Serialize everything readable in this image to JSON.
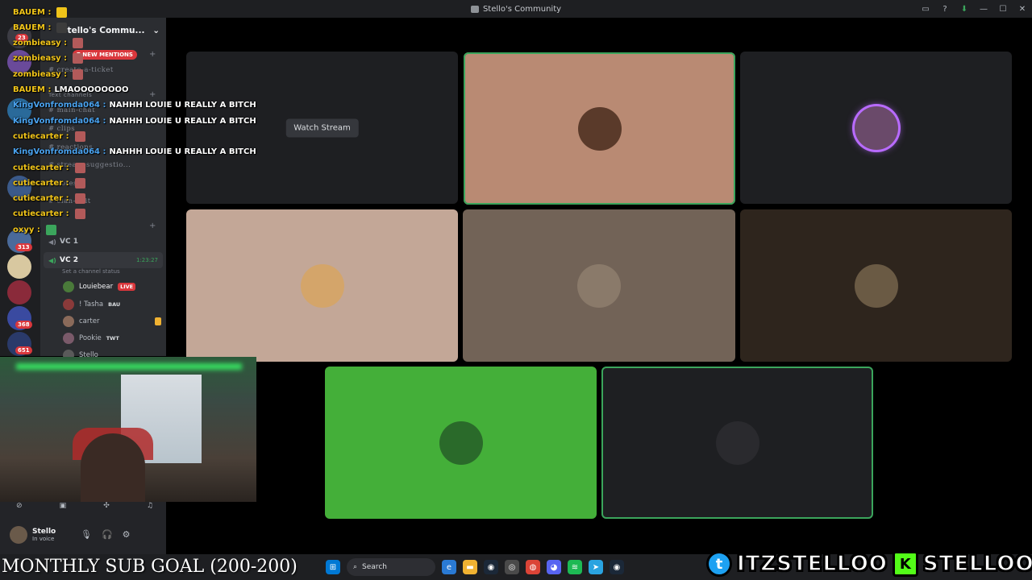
{
  "window": {
    "title": "Stello's Community"
  },
  "server": {
    "name": "Stello's Commu...",
    "new_mentions": "7 NEW MENTIONS",
    "badges": [
      "23",
      "313",
      "368",
      "651"
    ]
  },
  "channels": {
    "text_category": "Text channels",
    "items": [
      "create-a-ticket",
      "main-chat",
      "clips",
      "reactions",
      "stream-suggestio...",
      "votes",
      "clan-bait"
    ]
  },
  "voice": {
    "vc1": "VC 1",
    "vc2": "VC 2",
    "vc2_timer": "1:23:27",
    "vc2_status": "Set a channel status",
    "members": [
      {
        "name": "Louiebear",
        "badge": "LIVE"
      },
      {
        "name": "! Tasha",
        "tag": "BAU"
      },
      {
        "name": "carter"
      },
      {
        "name": "Pookie",
        "tag": "TWT"
      },
      {
        "name": "Stello"
      }
    ]
  },
  "chat": [
    {
      "user": "BAUEM :",
      "color": "#f0c419",
      "msg": "",
      "emo": "#f0c419"
    },
    {
      "user": "BAUEM :",
      "color": "#f0c419",
      "msg": "",
      "emo": "#3c3c3c"
    },
    {
      "user": "zombieasy :",
      "color": "#f0c419",
      "msg": "",
      "emo": "#b25a5a"
    },
    {
      "user": "zombieasy :",
      "color": "#f0c419",
      "msg": "",
      "emo": "#b25a5a"
    },
    {
      "user": "zombieasy :",
      "color": "#f0c419",
      "msg": "",
      "emo": "#b25a5a"
    },
    {
      "user": "BAUEM :",
      "color": "#f0c419",
      "msg": "LMAOOOOOOOO",
      "emo": ""
    },
    {
      "user": "KingVonfromda064 :",
      "color": "#4aa3f0",
      "msg": "NAHHH LOUIE U REALLY A BITCH",
      "emo": ""
    },
    {
      "user": "KingVonfromda064 :",
      "color": "#4aa3f0",
      "msg": "NAHHH LOUIE U REALLY A BITCH",
      "emo": ""
    },
    {
      "user": "cutiecarter :",
      "color": "#f0c419",
      "msg": "",
      "emo": "#b25a5a"
    },
    {
      "user": "KingVonfromda064 :",
      "color": "#4aa3f0",
      "msg": "NAHHH LOUIE U REALLY A BITCH",
      "emo": ""
    },
    {
      "user": "cutiecarter :",
      "color": "#f0c419",
      "msg": "",
      "emo": "#b25a5a"
    },
    {
      "user": "cutiecarter :",
      "color": "#f0c419",
      "msg": "",
      "emo": "#b25a5a"
    },
    {
      "user": "cutiecarter :",
      "color": "#f0c419",
      "msg": "",
      "emo": "#b25a5a"
    },
    {
      "user": "cutiecarter :",
      "color": "#f0c419",
      "msg": "",
      "emo": "#b25a5a"
    },
    {
      "user": "oxyy :",
      "color": "#f0c419",
      "msg": "",
      "emo": "#3ba55c"
    }
  ],
  "stage": {
    "watch_stream": "Watch Stream",
    "tiles": [
      {
        "bg": "#1e1f22",
        "stream": true
      },
      {
        "bg": "#b98a73",
        "avatar": "#5a3a2a",
        "speaking": true
      },
      {
        "bg": "#1e1f22",
        "avatar": "#6a4a6a",
        "ring": "#b86bff"
      },
      {
        "bg": "#c3a797",
        "avatar": "#d4a56a"
      },
      {
        "bg": "#726357",
        "avatar": "#8a7a6a"
      },
      {
        "bg": "#2e251d",
        "avatar": "#6a5a44"
      },
      {
        "bg": "#44af39",
        "avatar": "#2a6a2a"
      },
      {
        "bg": "#1e1f22",
        "avatar": "#2a2a2e",
        "speaking": true
      }
    ]
  },
  "user_panel": {
    "name": "Stello",
    "status": "In voice"
  },
  "overlay": {
    "goal": "MONTHLY SUB GOAL (200-200)",
    "twitter": "ITZSTELLOO",
    "kick": "STELLOOO"
  },
  "taskbar": {
    "search": "Search"
  },
  "colors": {
    "accent": "#5865f2",
    "live": "#da373c",
    "speaking": "#3ba55c",
    "twitter": "#1da1f2",
    "kick": "#53fc18"
  }
}
